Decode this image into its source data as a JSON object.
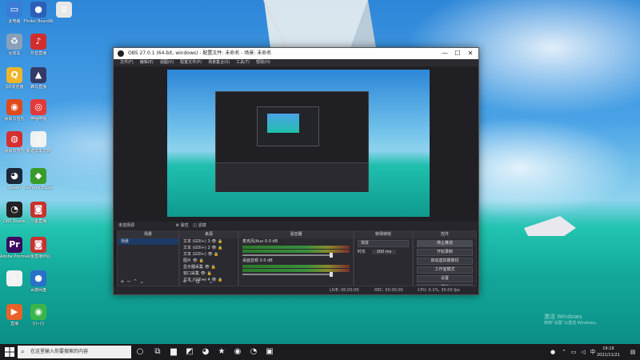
{
  "desktop": {
    "icons": [
      {
        "label": "此电脑",
        "glyph": "▭",
        "color": "#3a7bd5"
      },
      {
        "label": "Finder BoardWin",
        "glyph": "●",
        "color": "#2d5fb8"
      },
      {
        "label": "",
        "glyph": "≡",
        "color": "#e8e8e8"
      },
      {
        "label": "回收站",
        "glyph": "♻",
        "color": "#8aa0b8"
      },
      {
        "label": "抖音直播",
        "glyph": "♪",
        "color": "#d22d2d"
      },
      {
        "label": "QQ浏览器",
        "glyph": "Q",
        "color": "#f0b429"
      },
      {
        "label": "蜂鸟直播",
        "glyph": "▲",
        "color": "#333a66"
      },
      {
        "label": "网易云音乐",
        "glyph": "◉",
        "color": "#e04a1a"
      },
      {
        "label": "哔哩哔哩",
        "glyph": "◎",
        "color": "#e23a3a"
      },
      {
        "label": "网易云音乐",
        "glyph": "◍",
        "color": "#d62f2f"
      },
      {
        "label": "新建文本文档",
        "glyph": "▯",
        "color": "#f2f2f2"
      },
      {
        "label": "Steam",
        "glyph": "◕",
        "color": "#1b2838"
      },
      {
        "label": "GeForce Experience",
        "glyph": "◆",
        "color": "#3a9b2a"
      },
      {
        "label": "OBS Studio",
        "glyph": "◔",
        "color": "#222"
      },
      {
        "label": "斗鱼直播",
        "glyph": "◙",
        "color": "#c7322f"
      },
      {
        "label": "Adobe Premiere",
        "glyph": "Pr",
        "color": "#3a0b5e"
      },
      {
        "label": "斗鱼直播伴侣",
        "glyph": "◙",
        "color": "#c7322f"
      },
      {
        "label": "",
        "glyph": "▯",
        "color": "#f2f2f2"
      },
      {
        "label": "百度网盘",
        "glyph": "●",
        "color": "#2a70c8"
      },
      {
        "label": "直播",
        "glyph": "▶",
        "color": "#e8622a"
      },
      {
        "label": "(((•)))",
        "glyph": "◉",
        "color": "#3ab54a"
      }
    ],
    "watermark_line1": "激活 Windows",
    "watermark_line2": "转到“设置”以激活 Windows。"
  },
  "obs": {
    "title": "OBS 27.0.1 (64-bit, windows) - 配置文件: 未命名 - 场景: 未命名",
    "menu": [
      "文件(F)",
      "编辑(E)",
      "视图(V)",
      "配置文件(P)",
      "场景集合(S)",
      "工具(T)",
      "帮助(H)"
    ],
    "dock_header": "未选择源",
    "dock_tabs": [
      "属性",
      "滤镜"
    ],
    "panels": {
      "scenes_title": "场景",
      "scene_items": [
        "场景"
      ],
      "sources_title": "来源",
      "source_items": [
        "文本 (GDI+) 3",
        "文本 (GDI+) 2",
        "文本 (GDI+)",
        "图片",
        "显示器采集",
        "窗口采集",
        "文本 (GDI+) 4"
      ],
      "mixer_title": "混音器",
      "mixer_tracks": [
        {
          "name": "麦克风/Aux",
          "db": "0.0 dB"
        },
        {
          "name": "桌面音频",
          "db": "0.0 dB"
        }
      ],
      "transitions_title": "转场特效",
      "transition_value": "渐变",
      "duration_label": "时长",
      "duration_value": "300 ms",
      "controls_title": "控件",
      "controls": [
        "停止推流",
        "开始录制",
        "启动虚拟摄像机",
        "工作室模式",
        "设置",
        "退出"
      ]
    },
    "status": {
      "live": "LIVE: 00:00:00",
      "rec": "REC: 00:00:00",
      "cpu": "CPU: 0.1%, 30.00 fps"
    }
  },
  "taskbar": {
    "search_placeholder": "在这里输入你要搜索的内容",
    "time": "19:19",
    "date": "2021/11/21"
  }
}
